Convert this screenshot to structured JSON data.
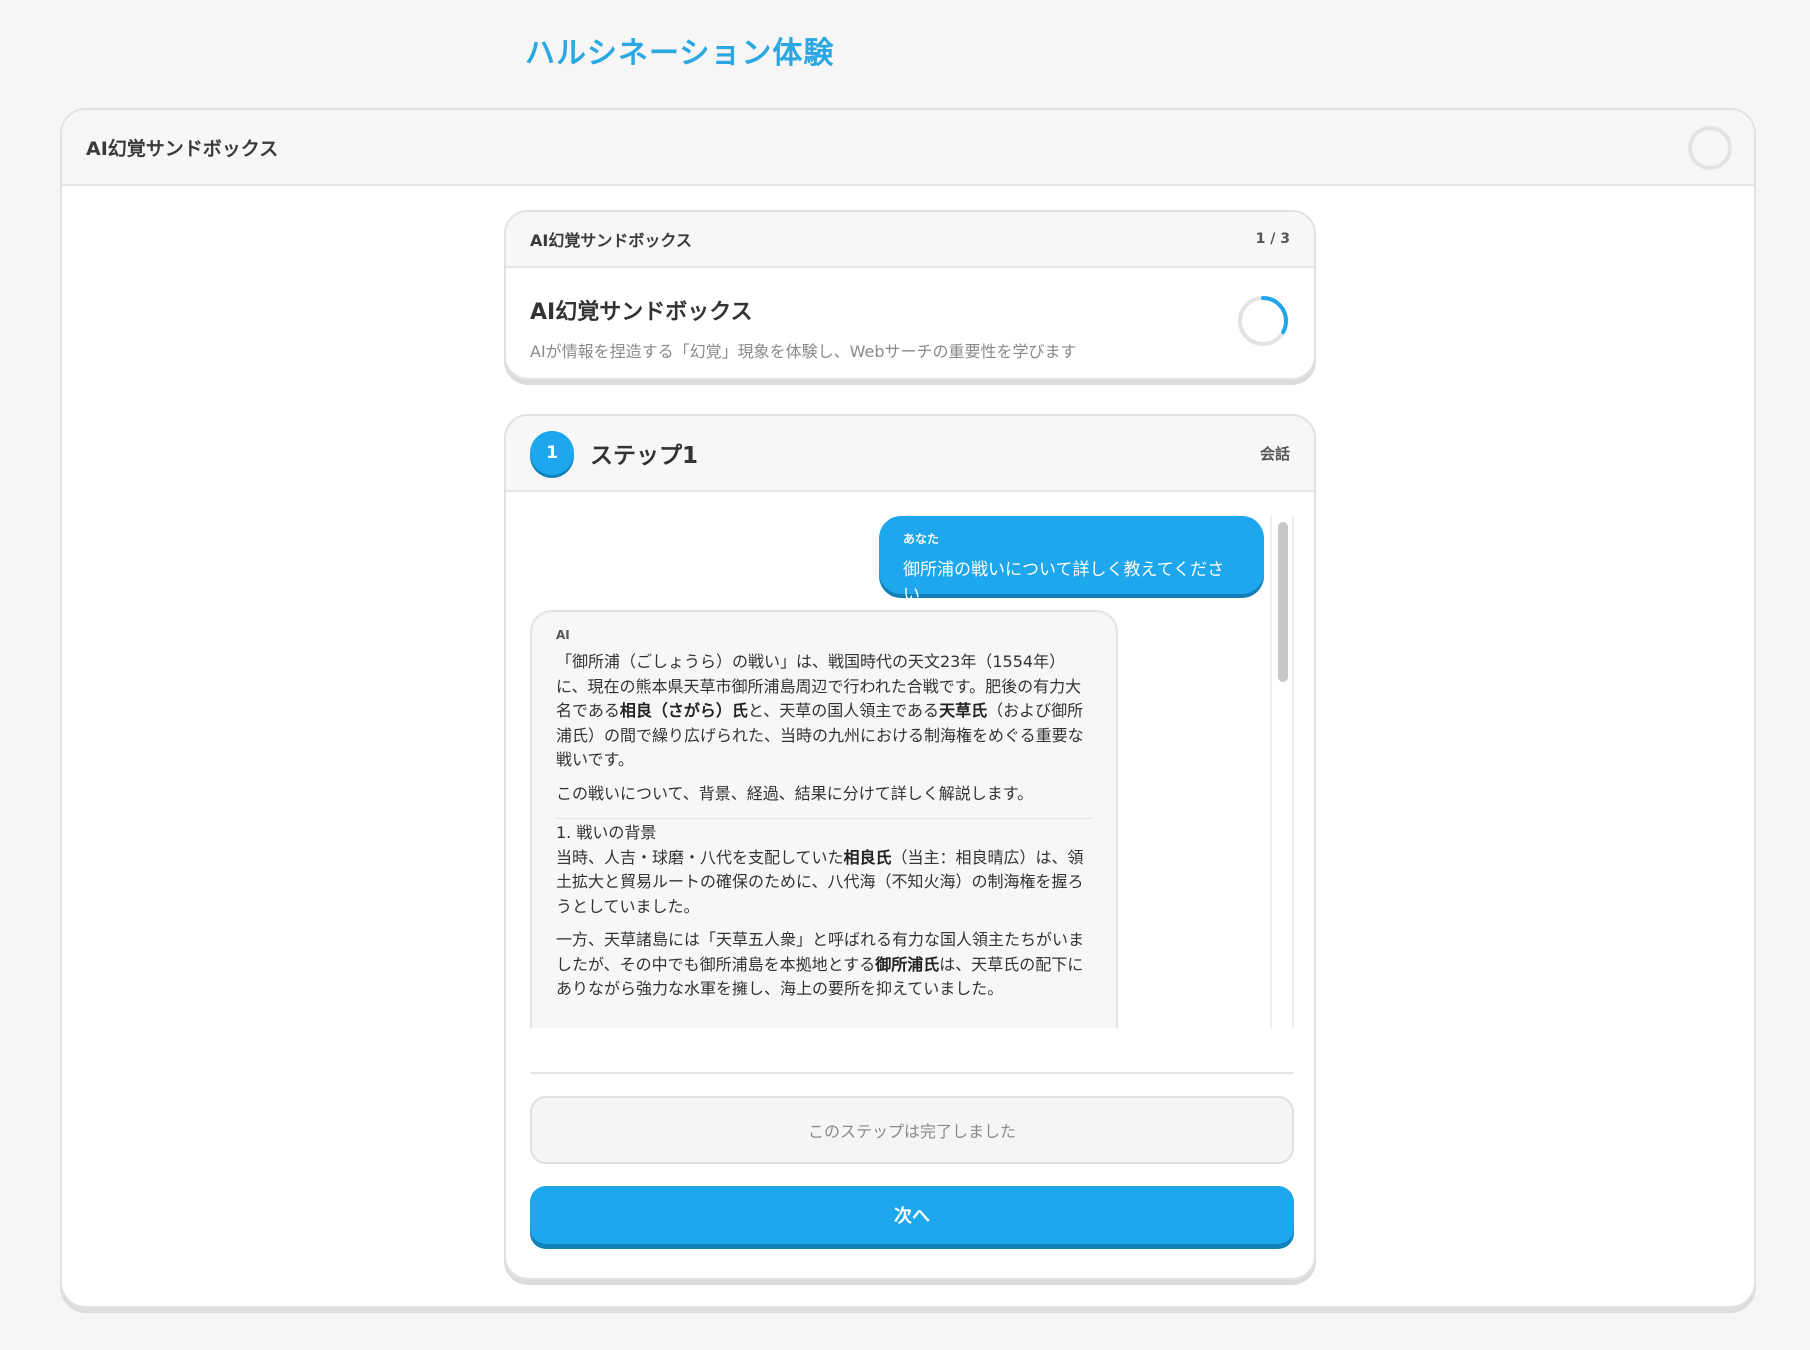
{
  "page_title": "ハルシネーション体験",
  "sandbox": {
    "title": "AI幻覚サンドボックス"
  },
  "overview_card": {
    "header_title": "AI幻覚サンドボックス",
    "counter": "1 / 3",
    "heading": "AI幻覚サンドボックス",
    "description": "AIが情報を捏造する「幻覚」現象を体験し、Webサーチの重要性を学びます",
    "progress_fraction": 0.33
  },
  "step": {
    "number": "1",
    "title": "ステップ1",
    "tag": "会話"
  },
  "chat": {
    "user_label": "あなた",
    "user_message": "御所浦の戦いについて詳しく教えてください",
    "ai_label": "AI",
    "ai_paragraphs": [
      {
        "segments": [
          {
            "text": "「御所浦（ごしょうら）の戦い」は、戦国時代の天文23年（1554年）に、現在の熊本県天草市御所浦島周辺で行われた合戦です。肥後の有力大名である",
            "bold": false
          },
          {
            "text": "相良（さがら）氏",
            "bold": true
          },
          {
            "text": "と、天草の国人領主である",
            "bold": false
          },
          {
            "text": "天草氏",
            "bold": true
          },
          {
            "text": "（および御所浦氏）の間で繰り広げられた、当時の九州における制海権をめぐる重要な戦いです。",
            "bold": false
          }
        ]
      },
      {
        "segments": [
          {
            "text": "この戦いについて、背景、経過、結果に分けて詳しく解説します。",
            "bold": false
          }
        ]
      },
      {
        "rule_before": true,
        "segments": [
          {
            "text": "1. 戦いの背景",
            "bold": false,
            "line_break_after": true
          },
          {
            "text": "当時、人吉・球磨・八代を支配していた",
            "bold": false
          },
          {
            "text": "相良氏",
            "bold": true
          },
          {
            "text": "（当主：相良晴広）は、領土拡大と貿易ルートの確保のために、八代海（不知火海）の制海権を握ろうとしていました。",
            "bold": false
          }
        ]
      },
      {
        "segments": [
          {
            "text": "一方、天草諸島には「天草五人衆」と呼ばれる有力な国人領主たちがいましたが、その中でも御所浦島を本拠地とする",
            "bold": false
          },
          {
            "text": "御所浦氏",
            "bold": true
          },
          {
            "text": "は、天草氏の配下にありながら強力な水軍を擁し、海上の要所を抑えていました。",
            "bold": false
          }
        ]
      }
    ]
  },
  "footer": {
    "completed_text": "このステップは完了しました",
    "next_label": "次へ"
  },
  "colors": {
    "accent": "#1ea7ec",
    "title": "#2ba7e3"
  }
}
